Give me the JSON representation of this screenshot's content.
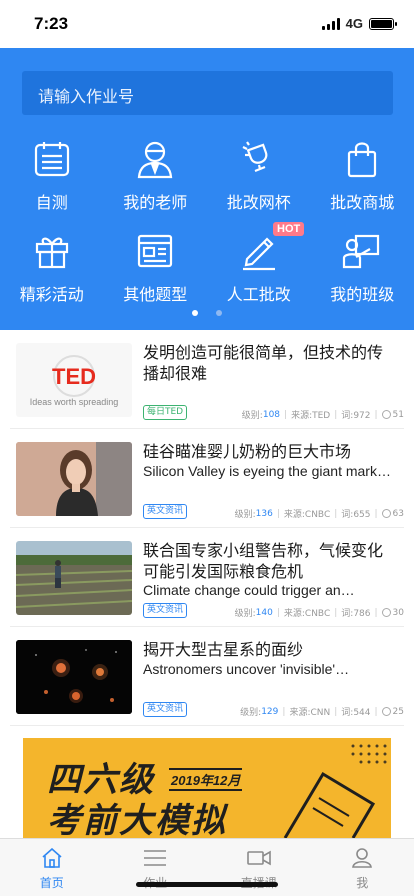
{
  "status": {
    "time": "7:23",
    "network": "4G"
  },
  "search": {
    "placeholder": "请输入作业号"
  },
  "quick_menu": [
    {
      "label": "自测",
      "icon": "calendar-icon"
    },
    {
      "label": "我的老师",
      "icon": "teacher-icon"
    },
    {
      "label": "批改网杯",
      "icon": "trophy-icon"
    },
    {
      "label": "批改商城",
      "icon": "shopping-bag-icon"
    },
    {
      "label": "精彩活动",
      "icon": "gift-icon"
    },
    {
      "label": "其他题型",
      "icon": "browser-window-icon"
    },
    {
      "label": "人工批改",
      "icon": "pen-icon",
      "badge": "HOT"
    },
    {
      "label": "我的班级",
      "icon": "classroom-icon"
    }
  ],
  "pager": {
    "pages": 2,
    "active": 0
  },
  "articles": [
    {
      "title": "发明创造可能很简单，但技术的传播却很难",
      "subtitle": "",
      "tag": "每日TED",
      "tag_color": "#3cb371",
      "level_label": "级别:",
      "level": "108",
      "source": "来源:TED",
      "words": "词:972",
      "coins": "51",
      "thumb": "ted-logo",
      "thumb_text": "TED",
      "thumb_caption": "Ideas worth spreading"
    },
    {
      "title": "硅谷瞄准婴儿奶粉的巨大市场",
      "subtitle": "Silicon Valley is eyeing the giant mark…",
      "tag": "英文资讯",
      "tag_color": "#2f87f2",
      "level_label": "级别:",
      "level": "136",
      "source": "来源:CNBC",
      "words": "词:655",
      "coins": "63",
      "thumb": "woman-portrait"
    },
    {
      "title": "联合国专家小组警告称，气候变化可能引发国际粮食危机",
      "subtitle": "Climate change could trigger an…",
      "tag": "英文资讯",
      "tag_color": "#2f87f2",
      "level_label": "级别:",
      "level": "140",
      "source": "来源:CNBC",
      "words": "词:786",
      "coins": "30",
      "thumb": "farmer-field"
    },
    {
      "title": "揭开大型古星系的面纱",
      "subtitle": "Astronomers uncover 'invisible'…",
      "tag": "英文资讯",
      "tag_color": "#2f87f2",
      "level_label": "级别:",
      "level": "129",
      "source": "来源:CNN",
      "words": "词:544",
      "coins": "25",
      "thumb": "galaxies"
    }
  ],
  "banner": {
    "line1": "四六级",
    "line2": "考前大模拟",
    "date": "2019年12月"
  },
  "tabs": [
    {
      "label": "首页",
      "icon": "home-icon",
      "active": true
    },
    {
      "label": "作业",
      "icon": "list-icon",
      "active": false
    },
    {
      "label": "直播课",
      "icon": "video-camera-icon",
      "active": false
    },
    {
      "label": "我",
      "icon": "user-icon",
      "active": false
    }
  ],
  "colors": {
    "primary": "#2f87f2",
    "search_bg": "#1f74dd",
    "tab_active": "#2f87f2",
    "tab_inactive": "#8a8a8a",
    "hot_badge": "#ff7a8a",
    "banner_bg": "#f4b52c"
  }
}
